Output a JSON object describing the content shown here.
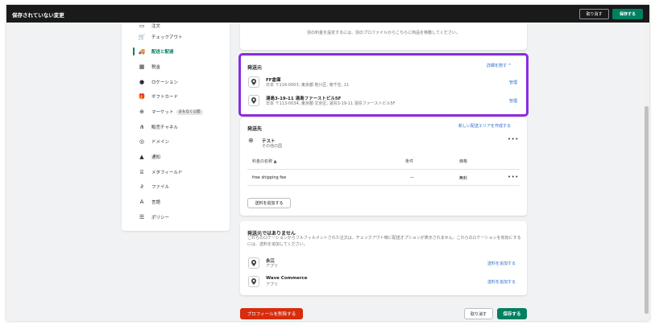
{
  "topbar": {
    "title": "保存されていない変更",
    "discard_label": "取り消す",
    "save_label": "保存する"
  },
  "sidebar": {
    "items": [
      {
        "label": "注文",
        "icon": "order-icon",
        "glyph": "▭"
      },
      {
        "label": "チェックアウト",
        "icon": "cart-icon",
        "glyph": "🛒"
      },
      {
        "label": "配送と配達",
        "icon": "truck-icon",
        "glyph": "🚚"
      },
      {
        "label": "税金",
        "icon": "tax-icon",
        "glyph": "▦"
      },
      {
        "label": "ロケーション",
        "icon": "location-icon",
        "glyph": "●"
      },
      {
        "label": "ギフトカード",
        "icon": "gift-icon",
        "glyph": "🎁"
      },
      {
        "label": "マーケット",
        "icon": "globe-icon",
        "glyph": "⊕",
        "badge": "まもなく公開"
      },
      {
        "label": "販売チャネル",
        "icon": "channels-icon",
        "glyph": "⋔"
      },
      {
        "label": "ドメイン",
        "icon": "domain-icon",
        "glyph": "◎"
      },
      {
        "label": "通知",
        "icon": "bell-icon",
        "glyph": "▲"
      },
      {
        "label": "メタフィールド",
        "icon": "metafield-icon",
        "glyph": "⌸"
      },
      {
        "label": "ファイル",
        "icon": "paperclip-icon",
        "glyph": "∂"
      },
      {
        "label": "言語",
        "icon": "language-icon",
        "glyph": "A"
      },
      {
        "label": "ポリシー",
        "icon": "policy-icon",
        "glyph": "☰"
      }
    ]
  },
  "top_card": {
    "note": "別の料金を設定するには、別のプロファイルからこちらに商品を移動してください。"
  },
  "origin": {
    "title": "発送元",
    "toggle_label": "詳細を隠す ^",
    "locations": [
      {
        "name": "FF倉庫",
        "address": "日本 〒116-0003, 東京都 荒川区, 南千住, 11",
        "action": "管理"
      },
      {
        "name": "湯島3-19-11 湯島ファーストビル5F",
        "address": "日本 〒113-0034, 東京都 文京区, 湯島3-19-11 湯島ファーストビル5F",
        "action": "管理"
      }
    ]
  },
  "destination": {
    "title": "発送先",
    "create_zone_label": "新しい配送エリアを作成する",
    "zone_name": "テスト",
    "zone_sub": "その他の国",
    "columns": {
      "name": "料金の名称 ▲",
      "condition": "条件",
      "price": "価格"
    },
    "rates": [
      {
        "name": "free shipping fee",
        "condition": "—",
        "price": "無料"
      }
    ],
    "add_rate_label": "送料を追加する"
  },
  "non_shipping": {
    "title": "発送元ではありません",
    "description": "これらのロケーションからフルフィルメントされた注文は、チェックアウト時に配送オプションが表示されません。これらのロケーションを有効にするには、送料を追加してください。",
    "locations": [
      {
        "name": "永江",
        "sub": "アプリ",
        "action": "送料を追加する"
      },
      {
        "name": "Wave Commerce",
        "sub": "アプリ",
        "action": "送料を追加する"
      }
    ]
  },
  "footer": {
    "delete_label": "プロフィールを削除する",
    "discard_label": "取り消す",
    "save_label": "保存する"
  },
  "colors": {
    "accent": "#008060",
    "danger": "#d72c0d",
    "link": "#2c6ecb",
    "highlight": "#8a2be2"
  }
}
